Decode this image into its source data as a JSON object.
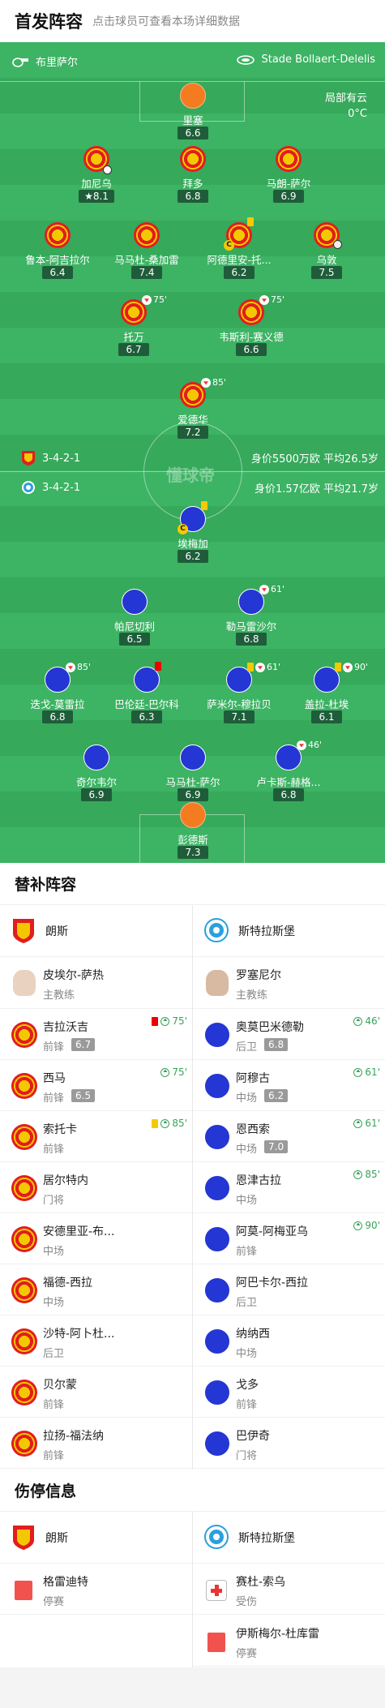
{
  "header": {
    "title": "首发阵容",
    "hint": "点击球员可查看本场详细数据"
  },
  "match": {
    "home_team": "布里萨尔",
    "venue": "Stade Bollaert-Delelis",
    "weather": "局部有云",
    "temperature": "0°C",
    "watermark": "懂球帝"
  },
  "home": {
    "formation": "3-4-2-1",
    "value": "身价5500万欧 平均26.5岁",
    "players": [
      {
        "name": "里塞",
        "rating": "6.6",
        "kit": "gk"
      },
      {
        "name": "加尼乌",
        "rating": "8.1",
        "star": true,
        "goal": true
      },
      {
        "name": "拜多",
        "rating": "6.8"
      },
      {
        "name": "马朗-萨尔",
        "rating": "6.9"
      },
      {
        "name": "鲁本-阿吉拉尔",
        "rating": "6.4"
      },
      {
        "name": "马马杜-桑加雷",
        "rating": "7.4"
      },
      {
        "name": "阿德里安-托...",
        "rating": "6.2",
        "captain": true,
        "yellow": true
      },
      {
        "name": "乌敦",
        "rating": "7.5",
        "assist": true
      },
      {
        "name": "托万",
        "rating": "6.7",
        "sub_min": "75'"
      },
      {
        "name": "韦斯利-赛义德",
        "rating": "6.6",
        "sub_min": "75'"
      },
      {
        "name": "爱德华",
        "rating": "7.2",
        "sub_min": "85'"
      }
    ]
  },
  "away": {
    "formation": "3-4-2-1",
    "value": "身价1.57亿欧 平均21.7岁",
    "players": [
      {
        "name": "埃梅加",
        "rating": "6.2",
        "captain": true,
        "yellow": true
      },
      {
        "name": "帕尼切利",
        "rating": "6.5"
      },
      {
        "name": "勒马雷沙尔",
        "rating": "6.8",
        "sub_min": "61'"
      },
      {
        "name": "迭戈-莫雷拉",
        "rating": "6.8",
        "sub_min": "85'"
      },
      {
        "name": "巴伦廷-巴尔科",
        "rating": "6.3",
        "red": true
      },
      {
        "name": "萨米尔-穆拉贝",
        "rating": "7.1",
        "yellow": true,
        "sub_min": "61'"
      },
      {
        "name": "盖拉-杜埃",
        "rating": "6.1",
        "yellow": true,
        "sub_min": "90'"
      },
      {
        "name": "奇尔韦尔",
        "rating": "6.9"
      },
      {
        "name": "马马杜-萨尔",
        "rating": "6.9"
      },
      {
        "name": "卢卡斯-赫格...",
        "rating": "6.8",
        "sub_min": "46'"
      },
      {
        "name": "彭德斯",
        "rating": "7.3",
        "kit": "gk"
      }
    ]
  },
  "subs": {
    "title": "替补阵容",
    "home_team": "朗斯",
    "away_team": "斯特拉斯堡",
    "home_coach": {
      "name": "皮埃尔-萨热",
      "role": "主教练"
    },
    "away_coach": {
      "name": "罗塞尼尔",
      "role": "主教练"
    },
    "home": [
      {
        "name": "吉拉沃吉",
        "pos": "前锋",
        "rating": "6.7",
        "min": "75'",
        "red": true
      },
      {
        "name": "西马",
        "pos": "前锋",
        "rating": "6.5",
        "min": "75'"
      },
      {
        "name": "索托卡",
        "pos": "前锋",
        "min": "85'",
        "yellow": true
      },
      {
        "name": "居尔特内",
        "pos": "门将"
      },
      {
        "name": "安德里亚-布...",
        "pos": "中场"
      },
      {
        "name": "福德-西拉",
        "pos": "中场"
      },
      {
        "name": "沙特-阿卜杜...",
        "pos": "后卫"
      },
      {
        "name": "贝尔蒙",
        "pos": "前锋"
      },
      {
        "name": "拉扬-福法纳",
        "pos": "前锋"
      }
    ],
    "away": [
      {
        "name": "奥莫巴米德勒",
        "pos": "后卫",
        "rating": "6.8",
        "min": "46'"
      },
      {
        "name": "阿穆古",
        "pos": "中场",
        "rating": "6.2",
        "min": "61'"
      },
      {
        "name": "恩西索",
        "pos": "中场",
        "rating": "7.0",
        "min": "61'"
      },
      {
        "name": "恩津古拉",
        "pos": "中场",
        "min": "85'"
      },
      {
        "name": "阿莫-阿梅亚乌",
        "pos": "前锋",
        "min": "90'"
      },
      {
        "name": "阿巴卡尔-西拉",
        "pos": "后卫"
      },
      {
        "name": "纳纳西",
        "pos": "中场"
      },
      {
        "name": "戈多",
        "pos": "前锋"
      },
      {
        "name": "巴伊奇",
        "pos": "门将"
      }
    ]
  },
  "injuries": {
    "title": "伤停信息",
    "home_team": "朗斯",
    "away_team": "斯特拉斯堡",
    "home": [
      {
        "name": "格雷迪特",
        "status": "停赛"
      }
    ],
    "away": [
      {
        "name": "赛杜-索乌",
        "status": "受伤"
      },
      {
        "name": "伊斯梅尔-杜库雷",
        "status": "停赛"
      }
    ]
  },
  "colors": {
    "pitch": "#3db364",
    "lens_red": "#e21d1d",
    "lens_yellow": "#f4c800",
    "str_blue": "#2436d3",
    "gk_orange": "#f47c20",
    "sub_green": "#38a35a"
  }
}
